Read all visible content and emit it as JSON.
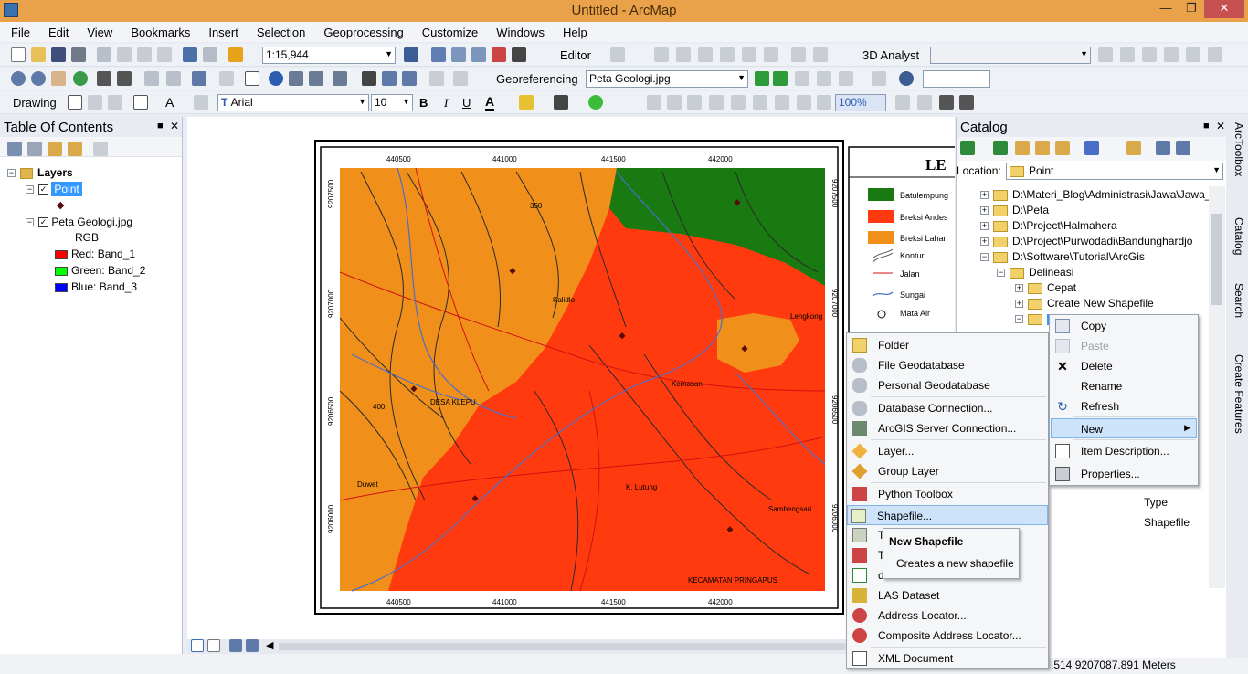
{
  "window": {
    "title": "Untitled - ArcMap",
    "min": "0",
    "restore": "1",
    "close": "r"
  },
  "menubar": {
    "items": [
      "File",
      "Edit",
      "View",
      "Bookmarks",
      "Insert",
      "Selection",
      "Geoprocessing",
      "Customize",
      "Windows",
      "Help"
    ]
  },
  "toolbar1": {
    "scale": "1:15,944",
    "editor": "Editor",
    "analyst": "3D Analyst"
  },
  "toolbar2": {
    "georef_label": "Georeferencing",
    "georef_layer": "Peta Geologi.jpg"
  },
  "toolbar3": {
    "drawing": "Drawing",
    "font": "Arial",
    "size": "10",
    "bold": "B",
    "italic": "I",
    "underline": "U",
    "font_color": "A",
    "percent": "100%"
  },
  "toc": {
    "title": "Table Of Contents",
    "layers_label": "Layers",
    "point_layer": "Point",
    "peta_layer": "Peta Geologi.jpg",
    "rgb": "RGB",
    "bands": [
      {
        "label": "Red:",
        "band": "Band_1",
        "color": "#ff0000"
      },
      {
        "label": "Green:",
        "band": "Band_2",
        "color": "#00ff00"
      },
      {
        "label": "Blue:",
        "band": "Band_3",
        "color": "#0000ff"
      }
    ]
  },
  "map": {
    "top_ticks": [
      "440500",
      "441000",
      "441500",
      "442000"
    ],
    "bottom_ticks": [
      "440500",
      "441000",
      "441500",
      "442000"
    ],
    "left_ticks": [
      "9207500",
      "9207000",
      "9206500",
      "9206000"
    ],
    "right_ticks": [
      "9207500",
      "9207000",
      "9206500",
      "9206000"
    ],
    "places": [
      "Kalidlo",
      "DESA KLEPU",
      "Kemasan",
      "Duwet",
      "K. Lutung",
      "Sambengsari",
      "KECAMATAN PRINGAPUS",
      "Lengkong"
    ],
    "contours": [
      "350",
      "400"
    ],
    "legend_title": "LE",
    "legend": [
      "Batulempung",
      "Breksi Andes",
      "Breksi Lahari",
      "Kontur",
      "Jalan",
      "Sungai",
      "Mata Air"
    ],
    "colors": {
      "green": "#1a7a12",
      "red": "#ff3a0f",
      "orange": "#f0901a"
    }
  },
  "status": {
    "coords": ".514  9207087.891 Meters"
  },
  "catalog": {
    "title": "Catalog",
    "location_label": "Location:",
    "location_value": "Point",
    "tree": [
      "D:\\Materi_Blog\\Administrasi\\Jawa\\Jawa_",
      "D:\\Peta",
      "D:\\Project\\Halmahera",
      "D:\\Project\\Purwodadi\\Bandunghardjo",
      "D:\\Software\\Tutorial\\ArcGis",
      "Delineasi",
      "Cepat",
      "Create New Shapefile"
    ],
    "contents_type_header": "Type",
    "contents_type_value": "Shapefile"
  },
  "context_menu": {
    "items": [
      "Copy",
      "Paste",
      "Delete",
      "Rename",
      "Refresh",
      "New",
      "Item Description...",
      "Properties..."
    ]
  },
  "new_submenu": {
    "items": [
      "Folder",
      "File Geodatabase",
      "Personal Geodatabase",
      "Database Connection...",
      "ArcGIS Server Connection...",
      "Layer...",
      "Group Layer",
      "Python Toolbox",
      "Shapefile...",
      "T",
      "T",
      "d",
      "LAS Dataset",
      "Address Locator...",
      "Composite Address Locator...",
      "XML Document"
    ]
  },
  "tooltip": {
    "title": "New Shapefile",
    "text": "Creates a new shapefile"
  },
  "side_tabs": [
    "ArcToolbox",
    "Catalog",
    "Search",
    "Create Features"
  ]
}
